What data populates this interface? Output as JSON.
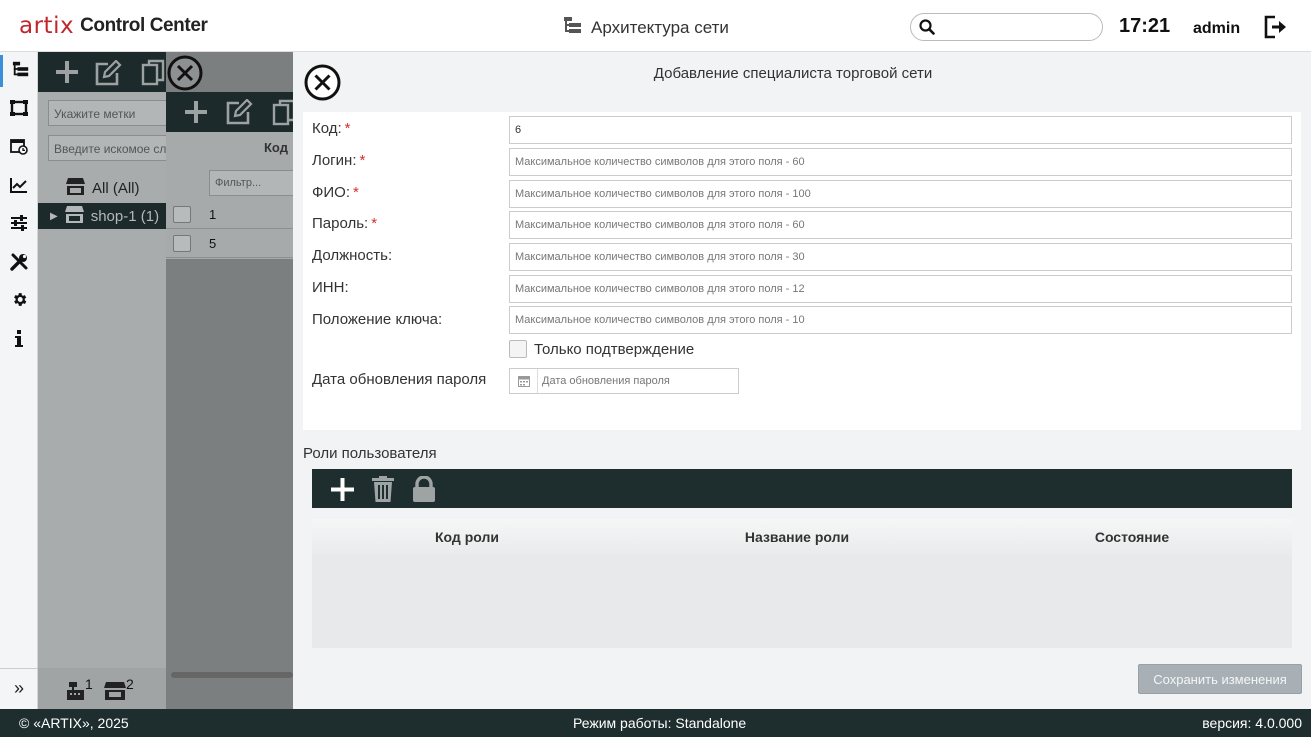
{
  "header": {
    "logo_text": "artix",
    "app_name": "Control Center",
    "section_title": "Архитектура сети",
    "search_value": "",
    "time": "17:21",
    "user": "admin"
  },
  "sidebar": {
    "items": [
      "network-tree-icon",
      "shop-icon",
      "schedule-icon",
      "chart-icon",
      "sliders-icon",
      "tools-icon",
      "gear-icon",
      "info-icon"
    ],
    "expand_label": "»"
  },
  "background": {
    "tags_placeholder": "Укажите метки",
    "search_placeholder": "Введите искомое слово",
    "tree": [
      {
        "label": "All (All)"
      },
      {
        "label": "shop-1 (1)"
      }
    ],
    "footer_counts": [
      "1",
      "2"
    ],
    "column_header": "Код",
    "filter_placeholder": "Фильтр...",
    "rows": [
      "1",
      "5"
    ]
  },
  "modal": {
    "title": "Добавление специалиста торговой сети",
    "fields": [
      {
        "label": "Код:",
        "required": true,
        "value": "6",
        "placeholder": ""
      },
      {
        "label": "Логин:",
        "required": true,
        "value": "",
        "placeholder": "Максимальное количество символов для этого поля - 60"
      },
      {
        "label": "ФИО:",
        "required": true,
        "value": "",
        "placeholder": "Максимальное количество символов для этого поля - 100"
      },
      {
        "label": "Пароль:",
        "required": true,
        "value": "",
        "placeholder": "Максимальное количество символов для этого поля - 60"
      },
      {
        "label": "Должность:",
        "required": false,
        "value": "",
        "placeholder": "Максимальное количество символов для этого поля - 30"
      },
      {
        "label": "ИНН:",
        "required": false,
        "value": "",
        "placeholder": "Максимальное количество символов для этого поля - 12"
      },
      {
        "label": "Положение ключа:",
        "required": false,
        "value": "",
        "placeholder": "Максимальное количество символов для этого поля - 10"
      }
    ],
    "confirm_only_label": "Только подтверждение",
    "password_date_label": "Дата обновления пароля",
    "password_date_placeholder": "Дата обновления пароля",
    "required_mark": "*",
    "roles": {
      "title": "Роли пользователя",
      "columns": [
        "Код роли",
        "Название роли",
        "Состояние"
      ]
    },
    "save_label": "Сохранить изменения"
  },
  "footer": {
    "copyright": "© «ARTIX», 2025",
    "mode": "Режим работы: Standalone",
    "version": "версия: 4.0.000"
  }
}
